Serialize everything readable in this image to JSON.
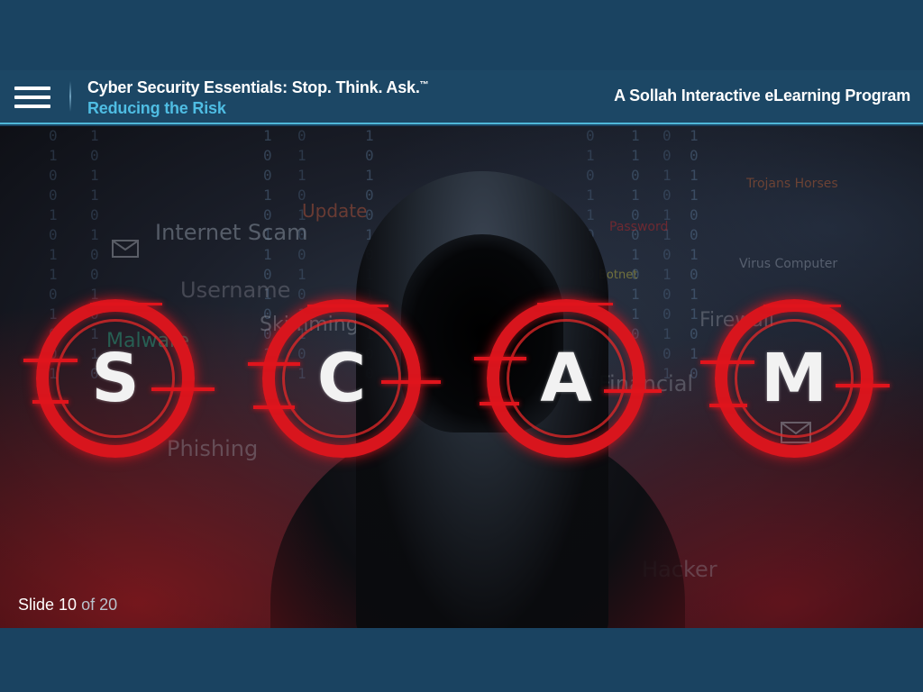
{
  "header": {
    "course_title": "Cyber Security Essentials: Stop. Think. Ask.",
    "course_title_mark": "™",
    "section_title": "Reducing the Risk",
    "program_label": "A Sollah Interactive eLearning Program",
    "menu_icon": "hamburger-menu-icon"
  },
  "slide": {
    "letters": [
      "S",
      "C",
      "A",
      "M"
    ],
    "background_words": [
      "Internet Scam",
      "Update",
      "Username",
      "Skimming",
      "Malware",
      "Phishing",
      "Trojans Horses",
      "Password",
      "Virus Computer",
      "Botnet",
      "Firewall",
      "Financial",
      "Hacker"
    ],
    "counter": {
      "prefix": "Slide",
      "current": "10",
      "of_label": "of 20"
    }
  },
  "colors": {
    "frame_bg": "#1a4361",
    "header_bg": "#1c4765",
    "accent_blue": "#4fbde3",
    "ring_red": "#d8151d"
  }
}
